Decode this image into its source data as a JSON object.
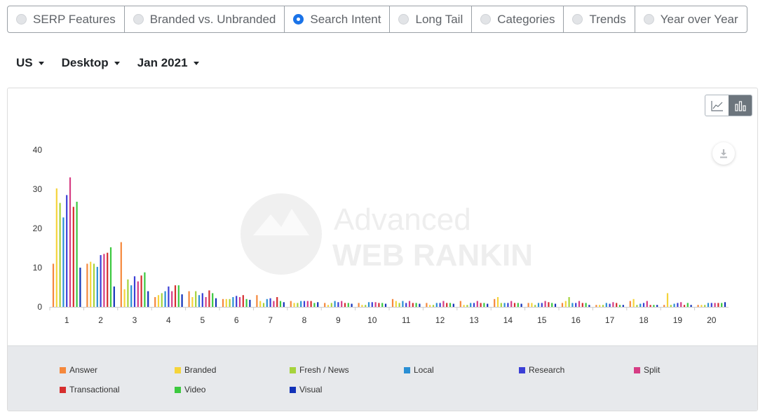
{
  "tabs": [
    {
      "label": "SERP Features",
      "selected": false
    },
    {
      "label": "Branded vs. Unbranded",
      "selected": false
    },
    {
      "label": "Search Intent",
      "selected": true
    },
    {
      "label": "Long Tail",
      "selected": false
    },
    {
      "label": "Categories",
      "selected": false
    },
    {
      "label": "Trends",
      "selected": false
    },
    {
      "label": "Year over Year",
      "selected": false
    }
  ],
  "filters": {
    "country": "US",
    "device": "Desktop",
    "date": "Jan 2021"
  },
  "chart_controls": {
    "line_icon": "line-chart-icon",
    "bar_icon": "bar-chart-icon",
    "download_icon": "download-icon",
    "active_view": "bar"
  },
  "watermark": {
    "line1": "Advanced",
    "line2": "WEB RANKING"
  },
  "colors": {
    "Answer": "#f5883c",
    "Branded": "#f5d43a",
    "Fresh / News": "#a6d33c",
    "Local": "#2a8fd4",
    "Research": "#3b3fd6",
    "Split": "#d63d84",
    "Transactional": "#d62e2e",
    "Video": "#3cc93f",
    "Visual": "#1232b8"
  },
  "chart_data": {
    "type": "bar",
    "title": "",
    "xlabel": "",
    "ylabel": "",
    "ylim": [
      0,
      40
    ],
    "yticks": [
      0,
      10,
      20,
      30,
      40
    ],
    "grid": false,
    "legend_position": "bottom",
    "categories": [
      "1",
      "2",
      "3",
      "4",
      "5",
      "6",
      "7",
      "8",
      "9",
      "10",
      "11",
      "12",
      "13",
      "14",
      "15",
      "16",
      "17",
      "18",
      "19",
      "20"
    ],
    "series": [
      {
        "name": "Answer",
        "values": [
          11,
          11,
          16.5,
          2.5,
          4,
          2,
          3,
          1.5,
          1,
          1,
          2,
          1,
          1.5,
          2,
          1,
          1,
          0.5,
          1.5,
          0.5,
          0.5
        ]
      },
      {
        "name": "Branded",
        "values": [
          30.2,
          11.5,
          4.5,
          3,
          2.5,
          2,
          1.5,
          1,
          0.5,
          0.5,
          1.5,
          0.5,
          0.5,
          2.5,
          1,
          1.5,
          0.5,
          2,
          3.5,
          0.5
        ]
      },
      {
        "name": "Fresh / News",
        "values": [
          26.5,
          11,
          7,
          3.5,
          4,
          2,
          1,
          1,
          1,
          0.5,
          1,
          0.5,
          0.5,
          1,
          0.5,
          2.5,
          0.5,
          0.5,
          0.5,
          0.5
        ]
      },
      {
        "name": "Local",
        "values": [
          22.8,
          10.2,
          5.5,
          4,
          3,
          2.5,
          2,
          1.5,
          1.5,
          1.2,
          1.5,
          1,
          1,
          1,
          1,
          1,
          1,
          0.8,
          0.8,
          1
        ]
      },
      {
        "name": "Research",
        "values": [
          28.5,
          13.2,
          7.8,
          5.2,
          3.5,
          2.8,
          2.2,
          1.5,
          1.2,
          1.2,
          1,
          1,
          1,
          1,
          1,
          1,
          0.8,
          1,
          1,
          1
        ]
      },
      {
        "name": "Split",
        "values": [
          33,
          13.5,
          6.5,
          4,
          2.5,
          2.5,
          1.5,
          1.5,
          1.5,
          1.2,
          1.5,
          1.5,
          1.5,
          1.5,
          1.5,
          1.5,
          1.2,
          1.5,
          1.2,
          1
        ]
      },
      {
        "name": "Transactional",
        "values": [
          25.5,
          13.8,
          8,
          5.5,
          4.2,
          3,
          2.5,
          1.5,
          1,
          1,
          1,
          1,
          1,
          1,
          1.2,
          1,
          1,
          0.5,
          0.5,
          1
        ]
      },
      {
        "name": "Video",
        "values": [
          26.8,
          15.2,
          8.8,
          5.5,
          3.5,
          2,
          1.5,
          1,
          1,
          1,
          1,
          1,
          1,
          1,
          1,
          1,
          0.5,
          0.5,
          1,
          1
        ]
      },
      {
        "name": "Visual",
        "values": [
          10,
          5.2,
          4,
          3.2,
          2.2,
          1.8,
          1.2,
          1.2,
          0.8,
          0.8,
          0.8,
          0.8,
          0.8,
          0.8,
          0.8,
          0.5,
          0.5,
          0.5,
          0.5,
          1.2
        ]
      }
    ]
  }
}
